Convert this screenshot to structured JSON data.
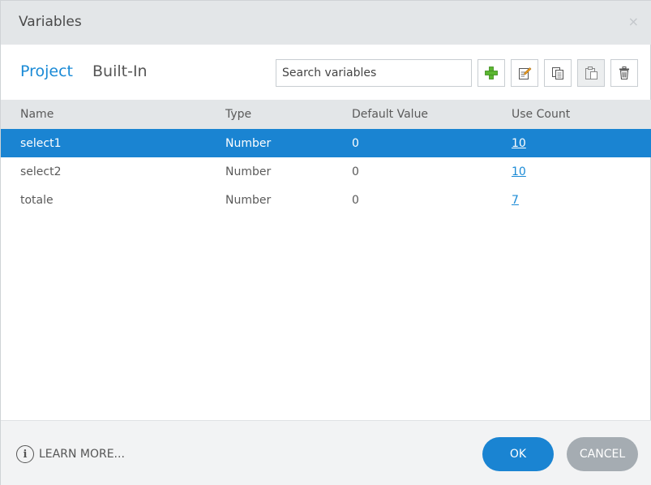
{
  "window": {
    "title": "Variables",
    "close_glyph": "×"
  },
  "tabs": [
    {
      "label": "Project",
      "active": true
    },
    {
      "label": "Built-In",
      "active": false
    }
  ],
  "search": {
    "placeholder": "Search variables",
    "value": ""
  },
  "toolbar": [
    {
      "icon": "add-icon",
      "name": "add-variable-button"
    },
    {
      "icon": "edit-icon",
      "name": "edit-variable-button"
    },
    {
      "icon": "copy-icon",
      "name": "copy-variable-button"
    },
    {
      "icon": "paste-icon",
      "name": "paste-variable-button",
      "disabled": true
    },
    {
      "icon": "trash-icon",
      "name": "delete-variable-button"
    }
  ],
  "table": {
    "columns": [
      "Name",
      "Type",
      "Default Value",
      "Use Count"
    ],
    "rows": [
      {
        "name": "select1",
        "type": "Number",
        "default": "0",
        "use_count": "10",
        "selected": true
      },
      {
        "name": "select2",
        "type": "Number",
        "default": "0",
        "use_count": "10",
        "selected": false
      },
      {
        "name": "totale",
        "type": "Number",
        "default": "0",
        "use_count": "7",
        "selected": false
      }
    ]
  },
  "footer": {
    "learn_more": "LEARN MORE...",
    "ok": "OK",
    "cancel": "CANCEL"
  },
  "colors": {
    "accent": "#1a84d2",
    "titlebar": "#e3e6e8",
    "cancel": "#a5acb2"
  }
}
